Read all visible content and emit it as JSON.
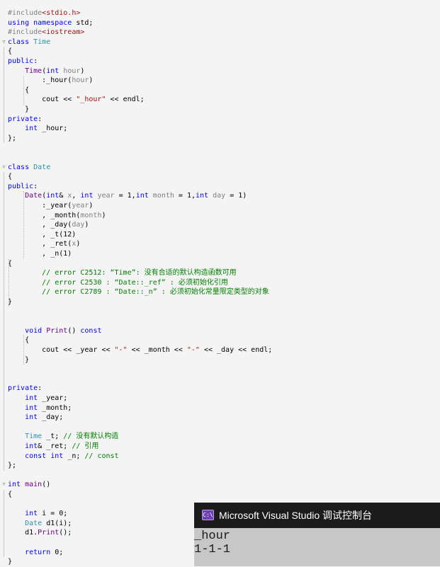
{
  "editor": {
    "lines": [
      {
        "tokens": [
          {
            "t": "#include",
            "c": "pp"
          },
          {
            "t": "<stdio.h>",
            "c": "str"
          }
        ]
      },
      {
        "tokens": [
          {
            "t": "using",
            "c": "kw"
          },
          {
            "t": " ",
            "c": "plain"
          },
          {
            "t": "namespace",
            "c": "kw"
          },
          {
            "t": " std;",
            "c": "plain"
          }
        ]
      },
      {
        "tokens": [
          {
            "t": "#include",
            "c": "pp"
          },
          {
            "t": "<iostream>",
            "c": "str"
          }
        ]
      },
      {
        "tokens": [
          {
            "t": "class",
            "c": "kw"
          },
          {
            "t": " ",
            "c": "plain"
          },
          {
            "t": "Time",
            "c": "type"
          }
        ]
      },
      {
        "tokens": [
          {
            "t": "{",
            "c": "plain"
          }
        ]
      },
      {
        "tokens": [
          {
            "t": "public",
            "c": "kw"
          },
          {
            "t": ":",
            "c": "plain"
          }
        ]
      },
      {
        "tokens": [
          {
            "t": "    ",
            "c": "plain"
          },
          {
            "t": "Time",
            "c": "macro"
          },
          {
            "t": "(",
            "c": "plain"
          },
          {
            "t": "int",
            "c": "kw"
          },
          {
            "t": " ",
            "c": "plain"
          },
          {
            "t": "hour",
            "c": "param"
          },
          {
            "t": ")",
            "c": "plain"
          }
        ]
      },
      {
        "tokens": [
          {
            "t": "        :_hour(",
            "c": "plain"
          },
          {
            "t": "hour",
            "c": "param"
          },
          {
            "t": ")",
            "c": "plain"
          }
        ]
      },
      {
        "tokens": [
          {
            "t": "    {",
            "c": "plain"
          }
        ]
      },
      {
        "tokens": [
          {
            "t": "        cout << ",
            "c": "plain"
          },
          {
            "t": "\"_hour\"",
            "c": "str"
          },
          {
            "t": " << endl;",
            "c": "plain"
          }
        ]
      },
      {
        "tokens": [
          {
            "t": "    }",
            "c": "plain"
          }
        ]
      },
      {
        "tokens": [
          {
            "t": "private",
            "c": "kw"
          },
          {
            "t": ":",
            "c": "plain"
          }
        ]
      },
      {
        "tokens": [
          {
            "t": "    ",
            "c": "plain"
          },
          {
            "t": "int",
            "c": "kw"
          },
          {
            "t": " _hour;",
            "c": "plain"
          }
        ]
      },
      {
        "tokens": [
          {
            "t": "};",
            "c": "plain"
          }
        ]
      },
      {
        "tokens": []
      },
      {
        "tokens": []
      },
      {
        "tokens": [
          {
            "t": "class",
            "c": "kw"
          },
          {
            "t": " ",
            "c": "plain"
          },
          {
            "t": "Date",
            "c": "type"
          }
        ]
      },
      {
        "tokens": [
          {
            "t": "{",
            "c": "plain"
          }
        ]
      },
      {
        "tokens": [
          {
            "t": "public",
            "c": "kw"
          },
          {
            "t": ":",
            "c": "plain"
          }
        ]
      },
      {
        "tokens": [
          {
            "t": "    ",
            "c": "plain"
          },
          {
            "t": "Date",
            "c": "macro"
          },
          {
            "t": "(",
            "c": "plain"
          },
          {
            "t": "int",
            "c": "kw"
          },
          {
            "t": "& ",
            "c": "plain"
          },
          {
            "t": "x",
            "c": "param"
          },
          {
            "t": ", ",
            "c": "plain"
          },
          {
            "t": "int",
            "c": "kw"
          },
          {
            "t": " ",
            "c": "plain"
          },
          {
            "t": "year",
            "c": "param"
          },
          {
            "t": " = 1,",
            "c": "plain"
          },
          {
            "t": "int",
            "c": "kw"
          },
          {
            "t": " ",
            "c": "plain"
          },
          {
            "t": "month",
            "c": "param"
          },
          {
            "t": " = 1,",
            "c": "plain"
          },
          {
            "t": "int",
            "c": "kw"
          },
          {
            "t": " ",
            "c": "plain"
          },
          {
            "t": "day",
            "c": "param"
          },
          {
            "t": " = 1)",
            "c": "plain"
          }
        ]
      },
      {
        "tokens": [
          {
            "t": "        :_year(",
            "c": "plain"
          },
          {
            "t": "year",
            "c": "param"
          },
          {
            "t": ")",
            "c": "plain"
          }
        ]
      },
      {
        "tokens": [
          {
            "t": "        , _month(",
            "c": "plain"
          },
          {
            "t": "month",
            "c": "param"
          },
          {
            "t": ")",
            "c": "plain"
          }
        ]
      },
      {
        "tokens": [
          {
            "t": "        , _day(",
            "c": "plain"
          },
          {
            "t": "day",
            "c": "param"
          },
          {
            "t": ")",
            "c": "plain"
          }
        ]
      },
      {
        "tokens": [
          {
            "t": "        , _t(12)",
            "c": "plain"
          }
        ]
      },
      {
        "tokens": [
          {
            "t": "        , _ret(",
            "c": "plain"
          },
          {
            "t": "x",
            "c": "param"
          },
          {
            "t": ")",
            "c": "plain"
          }
        ]
      },
      {
        "tokens": [
          {
            "t": "        , _n(1)",
            "c": "plain"
          }
        ]
      },
      {
        "tokens": [
          {
            "t": "{",
            "c": "plain"
          }
        ]
      },
      {
        "tokens": [
          {
            "t": "        // error C2512: “Time”: 没有合适的默认构造函数可用",
            "c": "cm"
          }
        ]
      },
      {
        "tokens": [
          {
            "t": "        // error C2530 : “Date::_ref” : 必须初始化引用",
            "c": "cm"
          }
        ]
      },
      {
        "tokens": [
          {
            "t": "        // error C2789 : “Date::_n” : 必须初始化常量限定类型的对象",
            "c": "cm"
          }
        ]
      },
      {
        "tokens": [
          {
            "t": "}",
            "c": "plain"
          }
        ]
      },
      {
        "tokens": []
      },
      {
        "tokens": []
      },
      {
        "tokens": [
          {
            "t": "    ",
            "c": "plain"
          },
          {
            "t": "void",
            "c": "kw"
          },
          {
            "t": " ",
            "c": "plain"
          },
          {
            "t": "Print",
            "c": "macro"
          },
          {
            "t": "() ",
            "c": "plain"
          },
          {
            "t": "const",
            "c": "kw"
          }
        ]
      },
      {
        "tokens": [
          {
            "t": "    {",
            "c": "plain"
          }
        ]
      },
      {
        "tokens": [
          {
            "t": "        cout << _year << ",
            "c": "plain"
          },
          {
            "t": "\"-\"",
            "c": "str"
          },
          {
            "t": " << _month << ",
            "c": "plain"
          },
          {
            "t": "\"-\"",
            "c": "str"
          },
          {
            "t": " << _day << endl;",
            "c": "plain"
          }
        ]
      },
      {
        "tokens": [
          {
            "t": "    }",
            "c": "plain"
          }
        ]
      },
      {
        "tokens": []
      },
      {
        "tokens": []
      },
      {
        "tokens": [
          {
            "t": "private",
            "c": "kw"
          },
          {
            "t": ":",
            "c": "plain"
          }
        ]
      },
      {
        "tokens": [
          {
            "t": "    ",
            "c": "plain"
          },
          {
            "t": "int",
            "c": "kw"
          },
          {
            "t": " _year;",
            "c": "plain"
          }
        ]
      },
      {
        "tokens": [
          {
            "t": "    ",
            "c": "plain"
          },
          {
            "t": "int",
            "c": "kw"
          },
          {
            "t": " _month;",
            "c": "plain"
          }
        ]
      },
      {
        "tokens": [
          {
            "t": "    ",
            "c": "plain"
          },
          {
            "t": "int",
            "c": "kw"
          },
          {
            "t": " _day;",
            "c": "plain"
          }
        ]
      },
      {
        "tokens": []
      },
      {
        "tokens": [
          {
            "t": "    ",
            "c": "plain"
          },
          {
            "t": "Time",
            "c": "type"
          },
          {
            "t": " _t; ",
            "c": "plain"
          },
          {
            "t": "// 没有默认构造",
            "c": "cm"
          }
        ]
      },
      {
        "tokens": [
          {
            "t": "    ",
            "c": "plain"
          },
          {
            "t": "int",
            "c": "kw"
          },
          {
            "t": "& _ret; ",
            "c": "plain"
          },
          {
            "t": "// 引用",
            "c": "cm"
          }
        ]
      },
      {
        "tokens": [
          {
            "t": "    ",
            "c": "plain"
          },
          {
            "t": "const",
            "c": "kw"
          },
          {
            "t": " ",
            "c": "plain"
          },
          {
            "t": "int",
            "c": "kw"
          },
          {
            "t": " _n; ",
            "c": "plain"
          },
          {
            "t": "// const",
            "c": "cm"
          }
        ]
      },
      {
        "tokens": [
          {
            "t": "};",
            "c": "plain"
          }
        ]
      },
      {
        "tokens": []
      },
      {
        "tokens": [
          {
            "t": "int",
            "c": "kw"
          },
          {
            "t": " ",
            "c": "plain"
          },
          {
            "t": "main",
            "c": "macro"
          },
          {
            "t": "()",
            "c": "plain"
          }
        ]
      },
      {
        "tokens": [
          {
            "t": "{",
            "c": "plain"
          }
        ]
      },
      {
        "tokens": []
      },
      {
        "tokens": [
          {
            "t": "    ",
            "c": "plain"
          },
          {
            "t": "int",
            "c": "kw"
          },
          {
            "t": " i = 0;",
            "c": "plain"
          }
        ]
      },
      {
        "tokens": [
          {
            "t": "    ",
            "c": "plain"
          },
          {
            "t": "Date",
            "c": "type"
          },
          {
            "t": " d1(i);",
            "c": "plain"
          }
        ]
      },
      {
        "tokens": [
          {
            "t": "    d1.",
            "c": "plain"
          },
          {
            "t": "Print",
            "c": "macro"
          },
          {
            "t": "();",
            "c": "plain"
          }
        ]
      },
      {
        "tokens": []
      },
      {
        "tokens": [
          {
            "t": "    ",
            "c": "plain"
          },
          {
            "t": "return",
            "c": "kw"
          },
          {
            "t": " 0;",
            "c": "plain"
          }
        ]
      },
      {
        "tokens": [
          {
            "t": "}",
            "c": "plain"
          }
        ]
      }
    ]
  },
  "console": {
    "title": "Microsoft Visual Studio 调试控制台",
    "icon_text": "C:\\",
    "icon": "console-app-icon",
    "output": [
      "_hour",
      "1-1-1"
    ]
  },
  "colors": {
    "editor_bg": "#f4f4f4",
    "keyword": "#0000ff",
    "string": "#a31515",
    "comment": "#008000",
    "type": "#2b91af",
    "console_title_bg": "#1b1b1b",
    "console_bg": "#c7c7c7"
  }
}
